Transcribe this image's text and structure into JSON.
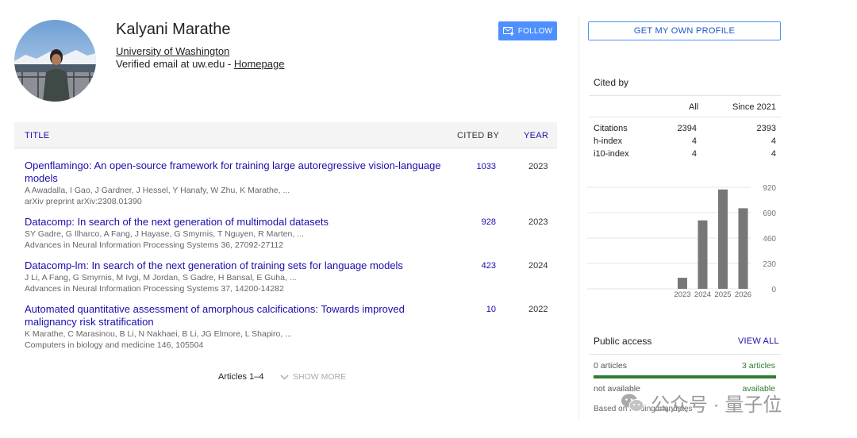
{
  "profile": {
    "name": "Kalyani Marathe",
    "affiliation": "University of Washington",
    "email_text": "Verified email at uw.edu - ",
    "homepage_label": "Homepage",
    "follow_label": "FOLLOW"
  },
  "table": {
    "headers": {
      "title": "TITLE",
      "cited_by": "CITED BY",
      "year": "YEAR"
    },
    "articles": [
      {
        "title": "Openflamingo: An open-source framework for training large autoregressive vision-language models",
        "authors": "A Awadalla, I Gao, J Gardner, J Hessel, Y Hanafy, W Zhu, K Marathe, ...",
        "venue": "arXiv preprint arXiv:2308.01390",
        "cited": "1033",
        "year": "2023"
      },
      {
        "title": "Datacomp: In search of the next generation of multimodal datasets",
        "authors": "SY Gadre, G Ilharco, A Fang, J Hayase, G Smyrnis, T Nguyen, R Marten, ...",
        "venue": "Advances in Neural Information Processing Systems 36, 27092-27112",
        "cited": "928",
        "year": "2023"
      },
      {
        "title": "Datacomp-lm: In search of the next generation of training sets for language models",
        "authors": "J Li, A Fang, G Smyrnis, M Ivgi, M Jordan, S Gadre, H Bansal, E Guha, ...",
        "venue": "Advances in Neural Information Processing Systems 37, 14200-14282",
        "cited": "423",
        "year": "2024"
      },
      {
        "title": "Automated quantitative assessment of amorphous calcifications: Towards improved malignancy risk stratification",
        "authors": "K Marathe, C Marasinou, B Li, N Nakhaei, B Li, JG Elmore, L Shapiro, ...",
        "venue": "Computers in biology and medicine 146, 105504",
        "cited": "10",
        "year": "2022"
      }
    ],
    "count_label": "Articles 1–4",
    "show_more_label": "SHOW MORE"
  },
  "sidebar": {
    "get_profile_label": "GET MY OWN PROFILE",
    "cited_by_title": "Cited by",
    "col_all": "All",
    "col_since": "Since 2021",
    "rows": [
      {
        "label": "Citations",
        "all": "2394",
        "since": "2393"
      },
      {
        "label": "h-index",
        "all": "4",
        "since": "4"
      },
      {
        "label": "i10-index",
        "all": "4",
        "since": "4"
      }
    ],
    "public_access": {
      "title": "Public access",
      "view_all": "VIEW ALL",
      "left_count": "0 articles",
      "right_count": "3 articles",
      "left_status": "not available",
      "right_status": "available",
      "footer": "Based on funding mandates",
      "available_share": 1.0
    }
  },
  "chart_data": {
    "type": "bar",
    "categories": [
      "2023",
      "2024",
      "2025",
      "2026"
    ],
    "values": [
      100,
      620,
      900,
      730
    ],
    "y_ticks": [
      0,
      230,
      460,
      690,
      920
    ],
    "ylim": [
      0,
      920
    ],
    "grid": true,
    "bar_color": "#777777"
  },
  "watermark": {
    "text": "公众号 · 量子位"
  },
  "colors": {
    "link": "#1a0dab",
    "accent": "#4d90fe",
    "green": "#2e7d32"
  }
}
